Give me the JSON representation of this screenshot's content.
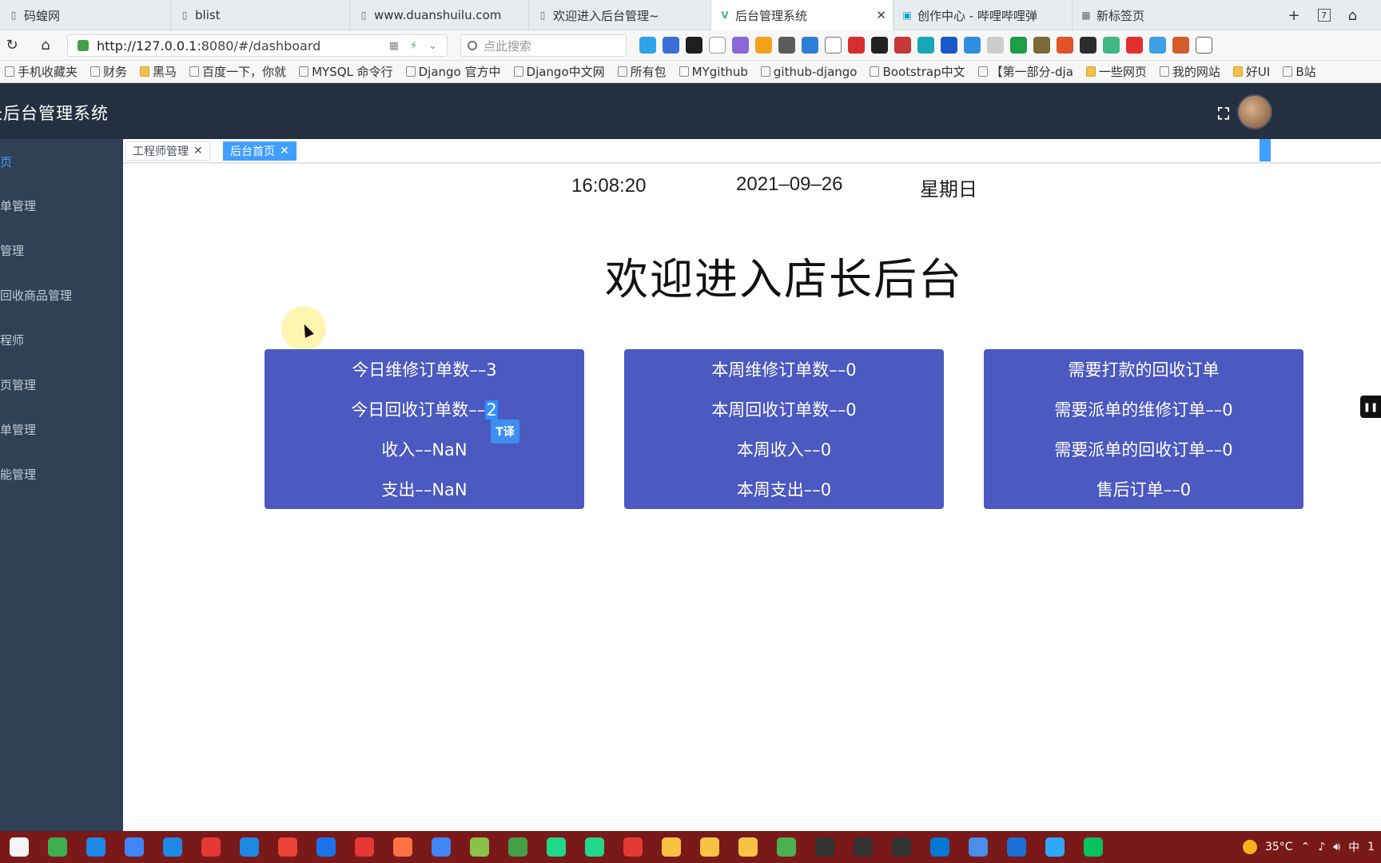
{
  "browser": {
    "tabs": [
      {
        "title": "码蝗网",
        "icon": "page-icon"
      },
      {
        "title": "blist",
        "icon": "page-icon"
      },
      {
        "title": "www.duanshuilu.com",
        "icon": "page-icon"
      },
      {
        "title": "欢迎进入后台管理~",
        "icon": "page-icon"
      },
      {
        "title": "后台管理系统",
        "icon": "vue-icon",
        "active": true
      },
      {
        "title": "创作中心 - 哔哩哔哩弹",
        "icon": "bilibili-icon"
      },
      {
        "title": "新标签页",
        "icon": "grid-icon"
      }
    ],
    "tab_tools": {
      "count": "7"
    },
    "url": {
      "host": "http://127.0.0.1",
      "rest": ":8080/#/dashboard"
    },
    "search_placeholder": "点此搜索",
    "bookmarks": [
      {
        "label": "手机收藏夹",
        "type": "page"
      },
      {
        "label": "财务",
        "type": "page"
      },
      {
        "label": "黑马",
        "type": "folder"
      },
      {
        "label": "百度一下，你就",
        "type": "page"
      },
      {
        "label": "MYSQL 命令行",
        "type": "page"
      },
      {
        "label": "Django 官方中",
        "type": "page"
      },
      {
        "label": "Django中文网",
        "type": "page"
      },
      {
        "label": "所有包",
        "type": "page"
      },
      {
        "label": "MYgithub",
        "type": "page"
      },
      {
        "label": "github-django",
        "type": "page"
      },
      {
        "label": "Bootstrap中文",
        "type": "page"
      },
      {
        "label": "【第一部分-dja",
        "type": "page"
      },
      {
        "label": "一些网页",
        "type": "folder"
      },
      {
        "label": "我的网站",
        "type": "page"
      },
      {
        "label": "好UI",
        "type": "folder"
      },
      {
        "label": "B站",
        "type": "page"
      }
    ]
  },
  "app": {
    "title": "长后台管理系统",
    "sidebar": [
      {
        "label": "页",
        "active": true
      },
      {
        "label": "单管理"
      },
      {
        "label": "管理"
      },
      {
        "label": "回收商品管理"
      },
      {
        "label": "程师"
      },
      {
        "label": "页管理"
      },
      {
        "label": "单管理"
      },
      {
        "label": "能管理"
      }
    ],
    "tags": [
      {
        "label": "工程师管理",
        "active": false
      },
      {
        "label": "后台首页",
        "active": true
      }
    ]
  },
  "dashboard": {
    "time": "16:08:20",
    "date": "2021–09–26",
    "weekday": "星期日",
    "welcome": "欢迎进入店长后台",
    "cards": [
      {
        "lines": [
          "今日维修订单数––3",
          "今日回收订单数––",
          "收入––NaN",
          "支出––NaN"
        ],
        "selected": "2"
      },
      {
        "lines": [
          "本周维修订单数––0",
          "本周回收订单数––0",
          "本周收入––0",
          "本周支出––0"
        ]
      },
      {
        "lines": [
          "需要打款的回收订单",
          "需要派单的维修订单––0",
          "需要派单的回收订单––0",
          "售后订单––0"
        ]
      }
    ],
    "translate_popup": "T译"
  },
  "taskbar": {
    "weather": "35°C",
    "ime": "中",
    "clock_partial": "1"
  },
  "colors": {
    "header": "#24303f",
    "sidebar": "#304156",
    "card": "#4b59c0",
    "accent": "#409eff",
    "taskbar": "#7a1919"
  }
}
